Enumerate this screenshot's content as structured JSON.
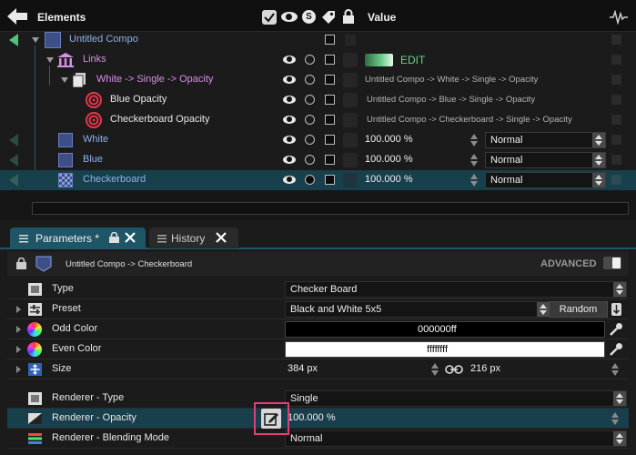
{
  "elements_panel": {
    "header": {
      "title": "Elements",
      "value_label": "Value"
    },
    "rows": [
      {
        "name": "Untitled Compo"
      },
      {
        "name": "Links",
        "value": "EDIT"
      },
      {
        "name": "White -> Single -> Opacity",
        "path": "Untitled Compo -> White -> Single -> Opacity"
      },
      {
        "name": "Blue Opacity",
        "path": "Untitled Compo -> Blue -> Single -> Opacity"
      },
      {
        "name": "Checkerboard Opacity",
        "path": "Untitled Compo -> Checkerboard -> Single -> Opacity"
      },
      {
        "name": "White",
        "value": "100.000 %",
        "blend": "Normal"
      },
      {
        "name": "Blue",
        "value": "100.000 %",
        "blend": "Normal"
      },
      {
        "name": "Checkerboard",
        "value": "100.000 %",
        "blend": "Normal"
      }
    ]
  },
  "tabs": [
    {
      "label": "Parameters *"
    },
    {
      "label": "History"
    }
  ],
  "params_panel": {
    "breadcrumb": "Untitled Compo -> Checkerboard",
    "advanced_label": "ADVANCED",
    "rows": {
      "type": {
        "label": "Type",
        "value": "Checker Board"
      },
      "preset": {
        "label": "Preset",
        "value": "Black and White 5x5",
        "button": "Random"
      },
      "odd_color": {
        "label": "Odd Color",
        "value": "000000ff",
        "swatch": "#000000"
      },
      "even_color": {
        "label": "Even Color",
        "value": "ffffffff",
        "swatch": "#ffffff"
      },
      "size": {
        "label": "Size",
        "width": "384 px",
        "height": "216 px"
      },
      "renderer_type": {
        "label": "Renderer - Type",
        "value": "Single"
      },
      "renderer_opacity": {
        "label": "Renderer - Opacity",
        "value": "100.000 %"
      },
      "renderer_blend": {
        "label": "Renderer - Blending Mode",
        "value": "Normal"
      }
    }
  },
  "colors": {
    "accent_selection": "#183f4c",
    "pink_annotation": "#e0407a",
    "links_green": "#4fc37a"
  }
}
